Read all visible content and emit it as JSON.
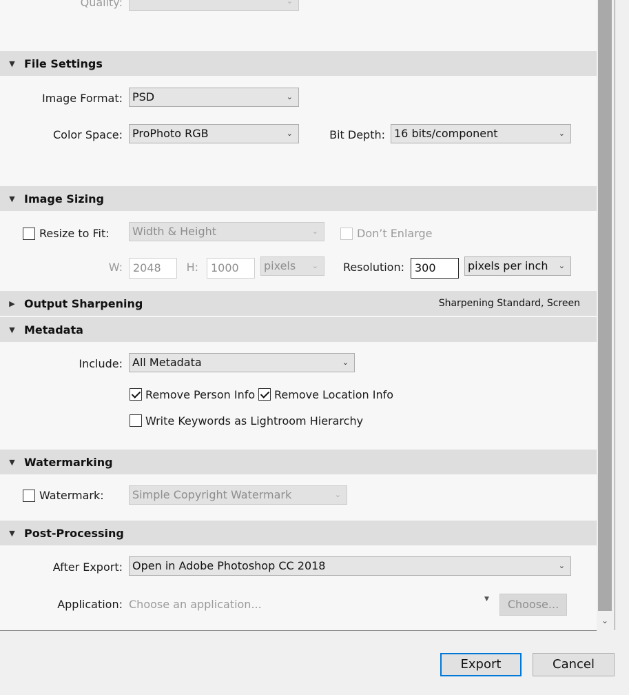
{
  "quality": {
    "label": "Quality:"
  },
  "file_settings": {
    "title": "File Settings",
    "image_format_label": "Image Format:",
    "image_format_value": "PSD",
    "color_space_label": "Color Space:",
    "color_space_value": "ProPhoto RGB",
    "bit_depth_label": "Bit Depth:",
    "bit_depth_value": "16 bits/component"
  },
  "image_sizing": {
    "title": "Image Sizing",
    "resize_label": "Resize to Fit:",
    "resize_checked": false,
    "resize_mode": "Width & Height",
    "dont_enlarge_label": "Don’t Enlarge",
    "w_label": "W:",
    "w_value": "2048",
    "h_label": "H:",
    "h_value": "1000",
    "units_value": "pixels",
    "resolution_label": "Resolution:",
    "resolution_value": "300",
    "resolution_units": "pixels per inch"
  },
  "output_sharpening": {
    "title": "Output Sharpening",
    "summary": "Sharpening Standard, Screen"
  },
  "metadata": {
    "title": "Metadata",
    "include_label": "Include:",
    "include_value": "All Metadata",
    "remove_person_label": "Remove Person Info",
    "remove_person_checked": true,
    "remove_location_label": "Remove Location Info",
    "remove_location_checked": true,
    "write_keywords_label": "Write Keywords as Lightroom Hierarchy",
    "write_keywords_checked": false
  },
  "watermarking": {
    "title": "Watermarking",
    "watermark_label": "Watermark:",
    "watermark_checked": false,
    "watermark_value": "Simple Copyright Watermark"
  },
  "post_processing": {
    "title": "Post-Processing",
    "after_export_label": "After Export:",
    "after_export_value": "Open in Adobe Photoshop CC 2018",
    "application_label": "Application:",
    "application_placeholder": "Choose an application...",
    "choose_button": "Choose..."
  },
  "footer": {
    "export_button": "Export",
    "cancel_button": "Cancel"
  },
  "icons": {
    "expanded": "▼",
    "collapsed": "▶",
    "dropdown": "chevron-down-icon"
  }
}
